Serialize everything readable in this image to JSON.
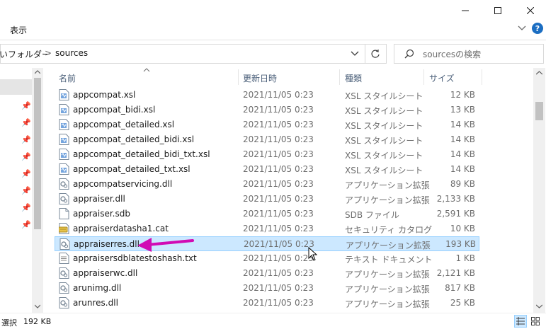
{
  "window": {
    "minimize_icon": "minimize-icon",
    "maximize_icon": "maximize-icon",
    "close_icon": "close-icon"
  },
  "ribbon": {
    "tab_view": "表示"
  },
  "address": {
    "parent_fragment": "いフォルダー",
    "separator": ">",
    "current": "sources"
  },
  "search": {
    "placeholder": "sourcesの検索"
  },
  "columns": {
    "name": "名前",
    "date": "更新日時",
    "type": "種類",
    "size": "サイズ"
  },
  "files": [
    {
      "name": "appcompat.xsl",
      "date": "2021/11/05 0:23",
      "type": "XSL スタイルシート",
      "size": "12 KB",
      "icon": "xsl"
    },
    {
      "name": "appcompat_bidi.xsl",
      "date": "2021/11/05 0:23",
      "type": "XSL スタイルシート",
      "size": "13 KB",
      "icon": "xsl"
    },
    {
      "name": "appcompat_detailed.xsl",
      "date": "2021/11/05 0:23",
      "type": "XSL スタイルシート",
      "size": "14 KB",
      "icon": "xsl"
    },
    {
      "name": "appcompat_detailed_bidi.xsl",
      "date": "2021/11/05 0:23",
      "type": "XSL スタイルシート",
      "size": "14 KB",
      "icon": "xsl"
    },
    {
      "name": "appcompat_detailed_bidi_txt.xsl",
      "date": "2021/11/05 0:23",
      "type": "XSL スタイルシート",
      "size": "14 KB",
      "icon": "xsl"
    },
    {
      "name": "appcompat_detailed_txt.xsl",
      "date": "2021/11/05 0:23",
      "type": "XSL スタイルシート",
      "size": "14 KB",
      "icon": "xsl"
    },
    {
      "name": "appcompatservicing.dll",
      "date": "2021/11/05 0:23",
      "type": "アプリケーション拡張",
      "size": "89 KB",
      "icon": "dll"
    },
    {
      "name": "appraiser.dll",
      "date": "2021/11/05 0:23",
      "type": "アプリケーション拡張",
      "size": "2,133 KB",
      "icon": "dll"
    },
    {
      "name": "appraiser.sdb",
      "date": "2021/11/05 0:23",
      "type": "SDB ファイル",
      "size": "2,591 KB",
      "icon": "blank"
    },
    {
      "name": "appraiserdatasha1.cat",
      "date": "2021/11/05 0:23",
      "type": "セキュリティ カタログ",
      "size": "10 KB",
      "icon": "cat"
    },
    {
      "name": "appraiserres.dll",
      "date": "2021/11/05 0:23",
      "type": "アプリケーション拡張",
      "size": "193 KB",
      "icon": "dll"
    },
    {
      "name": "appraisersdblatestoshash.txt",
      "date": "2021/11/05 0:23",
      "type": "テキスト ドキュメント",
      "size": "1 KB",
      "icon": "txt"
    },
    {
      "name": "appraiserwc.dll",
      "date": "2021/11/05 0:23",
      "type": "アプリケーション拡張",
      "size": "2,121 KB",
      "icon": "dll"
    },
    {
      "name": "arunimg.dll",
      "date": "2021/11/05 0:23",
      "type": "アプリケーション拡張",
      "size": "817 KB",
      "icon": "dll"
    },
    {
      "name": "arunres.dll",
      "date": "2021/11/05 0:23",
      "type": "アプリケーション拡張",
      "size": "25 KB",
      "icon": "dll"
    }
  ],
  "selected_index": 10,
  "annotation": {
    "arrow_color": "#d10bb4",
    "points_to": "appraiserres.dll"
  },
  "status": {
    "selection": "選択",
    "selection_size": "192 KB"
  },
  "colors": {
    "selection_bg": "#cce8ff",
    "selection_border": "#99d1ff",
    "header_text": "#4c607a"
  }
}
